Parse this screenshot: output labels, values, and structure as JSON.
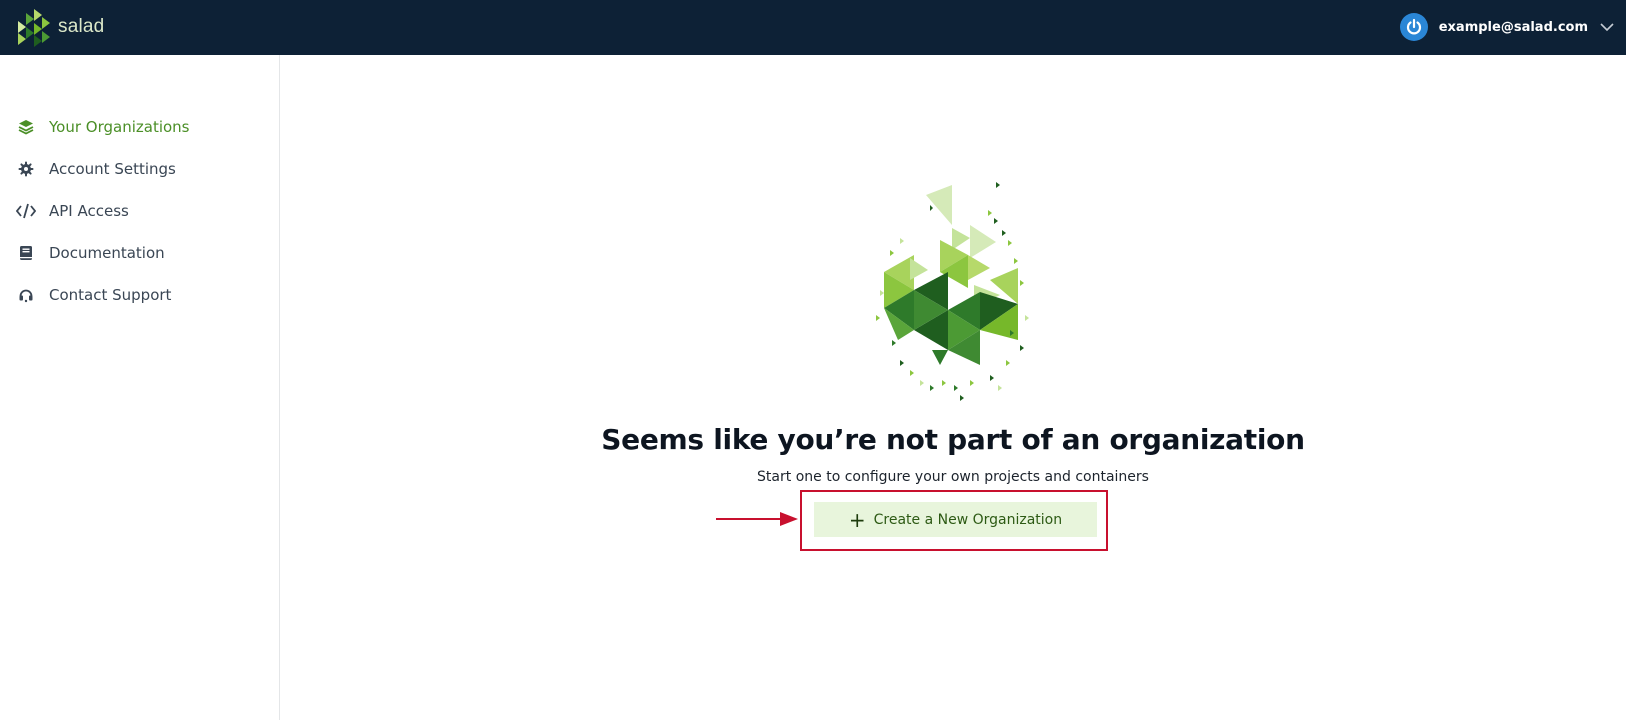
{
  "app": {
    "brand": "salad",
    "user_email": "example@salad.com"
  },
  "sidebar": {
    "items": [
      {
        "label": "Your Organizations",
        "icon": "layers-icon",
        "active": true
      },
      {
        "label": "Account Settings",
        "icon": "gear-icon",
        "active": false
      },
      {
        "label": "API Access",
        "icon": "code-icon",
        "active": false
      },
      {
        "label": "Documentation",
        "icon": "book-icon",
        "active": false
      },
      {
        "label": "Contact Support",
        "icon": "headset-icon",
        "active": false
      }
    ]
  },
  "main": {
    "headline": "Seems like you’re not part of an organization",
    "subline": "Start one to configure your own projects and containers",
    "create_button_label": "Create a New Organization",
    "create_button_icon": "plus-icon"
  },
  "colors": {
    "topbar": "#0d2136",
    "accent_green": "#4b8f27",
    "button_bg": "#e8f5dc",
    "annotation_red": "#c8102e",
    "avatar_blue": "#2a86d6"
  }
}
